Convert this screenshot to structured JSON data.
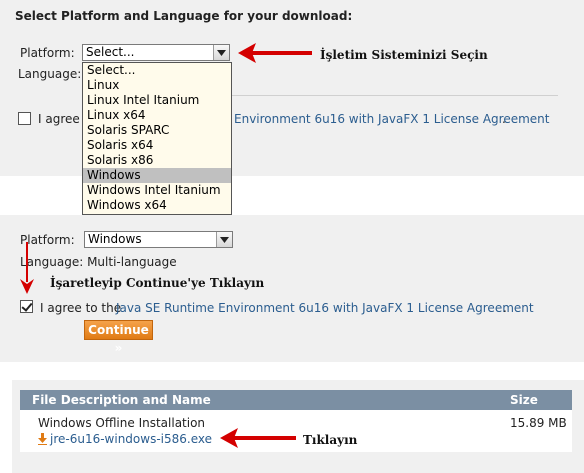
{
  "step1": {
    "heading": "Select Platform and Language for your download:",
    "platform_label": "Platform:",
    "platform_value": "Select...",
    "language_label": "Language:",
    "agree_prefix": "I agree t",
    "agree_link_tail": "Environment 6u16 with JavaFX 1 License Agreement",
    "agree_suffix": ".",
    "dropdown_options": [
      "Select...",
      "Linux",
      "Linux Intel Itanium",
      "Linux x64",
      "Solaris SPARC",
      "Solaris x64",
      "Solaris x86",
      "Windows",
      "Windows Intel Itanium",
      "Windows x64"
    ],
    "dropdown_selected": "Windows"
  },
  "step2": {
    "platform_label": "Platform:",
    "platform_value": "Windows",
    "language_text": "Language: Multi-language",
    "agree_prefix": "I agree to the",
    "agree_link": "Java SE Runtime Environment 6u16 with JavaFX 1 License Agreement",
    "agree_suffix": ".",
    "continue_label": "Continue »"
  },
  "table": {
    "col_description": "File Description and Name",
    "col_size": "Size",
    "row_name": "Windows Offline Installation",
    "row_file": "jre-6u16-windows-i586.exe",
    "row_size": "15.89 MB"
  },
  "annotations": {
    "select_os": "İşletim Sisteminizi Seçin",
    "check_continue": "İşaretleyip Continue'ye Tıklayın",
    "click": "Tıklayın"
  },
  "colors": {
    "arrow": "#d40000",
    "link": "#2b5d8f",
    "button": "#e98a26",
    "table_header": "#7b8fa3"
  }
}
